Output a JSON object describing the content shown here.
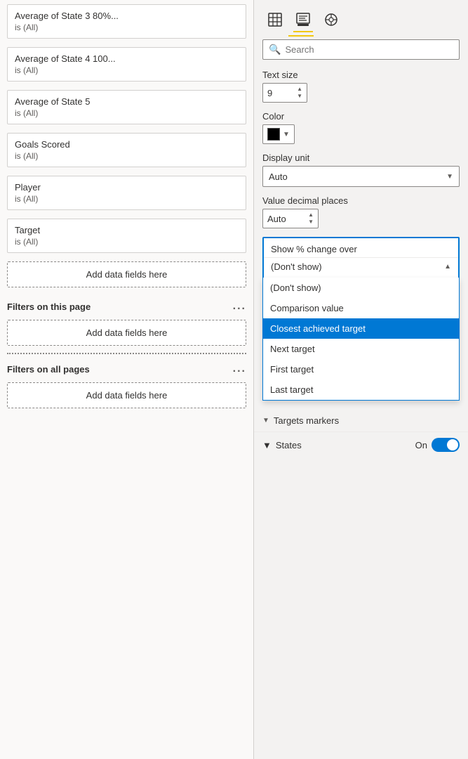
{
  "leftPanel": {
    "filters": [
      {
        "label": "Average of State 3 80%...",
        "value": "is (All)"
      },
      {
        "label": "Average of State 4 100...",
        "value": "is (All)"
      },
      {
        "label": "Average of State 5",
        "value": "is (All)"
      },
      {
        "label": "Goals Scored",
        "value": "is (All)"
      },
      {
        "label": "Player",
        "value": "is (All)"
      },
      {
        "label": "Target",
        "value": "is (All)"
      }
    ],
    "addFieldsLabel": "Add data fields here",
    "filtersOnThisPage": "Filters on this page",
    "filtersOnThisPageDots": "...",
    "filtersOnAllPages": "Filters on all pages",
    "filtersOnAllPagesDots": "..."
  },
  "rightPanel": {
    "icons": [
      {
        "id": "table-icon",
        "symbol": "⊞",
        "active": false
      },
      {
        "id": "format-icon",
        "symbol": "🖌",
        "active": true
      },
      {
        "id": "analytics-icon",
        "symbol": "◎",
        "active": false
      }
    ],
    "search": {
      "placeholder": "Search",
      "label": "Search"
    },
    "textSize": {
      "label": "Text size",
      "value": "9"
    },
    "color": {
      "label": "Color",
      "value": "#000000"
    },
    "displayUnit": {
      "label": "Display unit",
      "value": "Auto"
    },
    "valueDecimalPlaces": {
      "label": "Value decimal places",
      "value": "Auto"
    },
    "showPctChange": {
      "label": "Show % change over",
      "currentValue": "(Don't show)",
      "options": [
        {
          "id": "dont-show",
          "label": "(Don't show)",
          "selected": false
        },
        {
          "id": "comparison-value",
          "label": "Comparison value",
          "selected": false
        },
        {
          "id": "closest-achieved",
          "label": "Closest achieved target",
          "selected": true
        },
        {
          "id": "next-target",
          "label": "Next target",
          "selected": false
        },
        {
          "id": "first-target",
          "label": "First target",
          "selected": false
        },
        {
          "id": "last-target",
          "label": "Last target",
          "selected": false
        }
      ]
    },
    "targetsMarkersLabel": "Targets markers",
    "statesLabel": "States",
    "statesValue": "On"
  }
}
